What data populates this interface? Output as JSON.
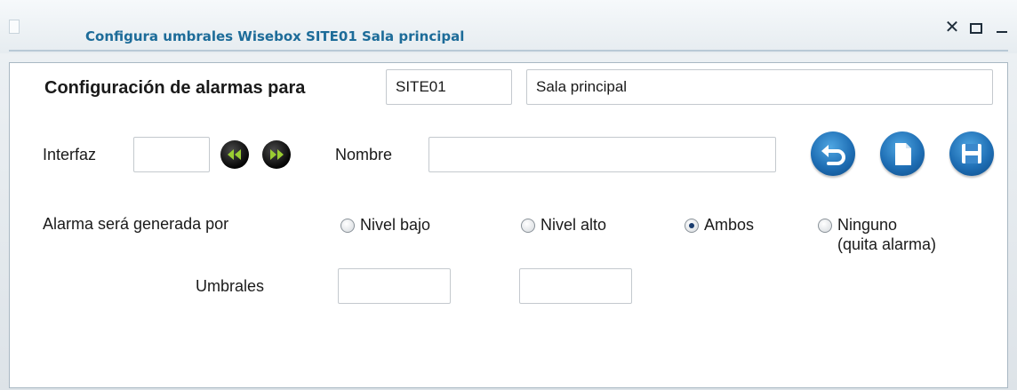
{
  "window": {
    "title": "Configura umbrales Wisebox SITE01 Sala principal",
    "controls": {
      "close": "close-icon",
      "maximize": "maximize-icon",
      "minimize": "minimize-icon"
    }
  },
  "form": {
    "config_label": "Configuración de alarmas para",
    "site_value": "SITE01",
    "room_value": "Sala principal",
    "interface_label": "Interfaz",
    "interface_value": "",
    "name_label": "Nombre",
    "name_value": "",
    "alarm_label": "Alarma será generada por",
    "options": [
      {
        "label": "Nivel bajo",
        "checked": false
      },
      {
        "label": "Nivel alto",
        "checked": false
      },
      {
        "label": "Ambos",
        "checked": true
      },
      {
        "label": "Ninguno",
        "label2": "(quita alarma)",
        "checked": false
      }
    ],
    "thresholds_label": "Umbrales",
    "threshold_low": "",
    "threshold_high": ""
  },
  "icons": {
    "prev": "rewind-icon",
    "next": "fast-forward-icon",
    "undo": "undo-icon",
    "new": "new-document-icon",
    "save": "save-icon"
  },
  "colors": {
    "title": "#1d6c99",
    "action_button": "#1f6fb5",
    "nav_button": "#111111",
    "nav_arrow": "#9acd32"
  }
}
